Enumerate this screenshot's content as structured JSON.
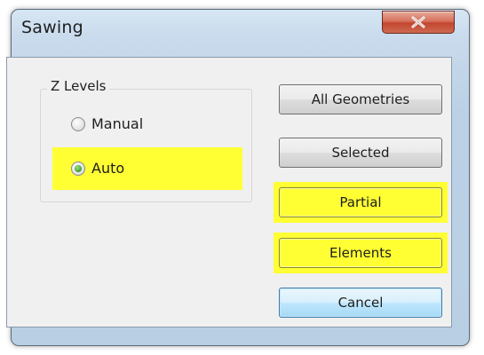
{
  "dialog": {
    "title": "Sawing"
  },
  "z_levels": {
    "label": "Z Levels",
    "options": [
      {
        "label": "Manual",
        "checked": false
      },
      {
        "label": "Auto",
        "checked": true
      }
    ]
  },
  "buttons": {
    "all_geometries": "All Geometries",
    "selected": "Selected",
    "partial": "Partial",
    "elements": "Elements",
    "cancel": "Cancel"
  },
  "colors": {
    "highlight": "#ffff33",
    "close_button": "#c2462f",
    "cancel_accent": "#3c7fb1"
  }
}
